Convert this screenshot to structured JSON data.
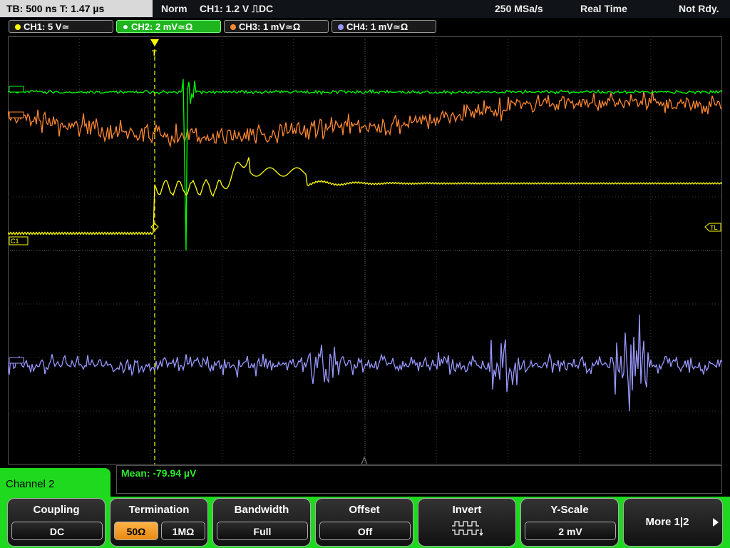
{
  "status": {
    "timebase": "TB: 500 ns  T: 1.47 µs",
    "mode": "Norm",
    "trigger": "CH1: 1.2 V ⎍DC",
    "sample_rate": "250 MSa/s",
    "acq_mode": "Real Time",
    "state": "Not Rdy."
  },
  "channels": [
    {
      "label": "CH1: 5 V≃",
      "color": "#ffff00"
    },
    {
      "label": "CH2: 2 mV≃Ω",
      "color": "#00ff00"
    },
    {
      "label": "CH3: 1 mV≃Ω",
      "color": "#ff8833"
    },
    {
      "label": "CH4: 1 mV≃Ω",
      "color": "#9999ff"
    }
  ],
  "markers": {
    "ch1": "C1",
    "trigger_level": "TL",
    "trigger_pos": "T"
  },
  "measurement": "Mean: -79.94 µV",
  "channel_menu": "Channel 2",
  "softkeys": {
    "coupling": {
      "title": "Coupling",
      "value": "DC"
    },
    "termination": {
      "title": "Termination",
      "opt1": "50Ω",
      "opt2": "1MΩ"
    },
    "bandwidth": {
      "title": "Bandwidth",
      "value": "Full"
    },
    "offset": {
      "title": "Offset",
      "value": "Off"
    },
    "invert": {
      "title": "Invert"
    },
    "yscale": {
      "title": "Y-Scale",
      "value": "2 mV"
    },
    "more": {
      "label": "More 1|2"
    }
  }
}
